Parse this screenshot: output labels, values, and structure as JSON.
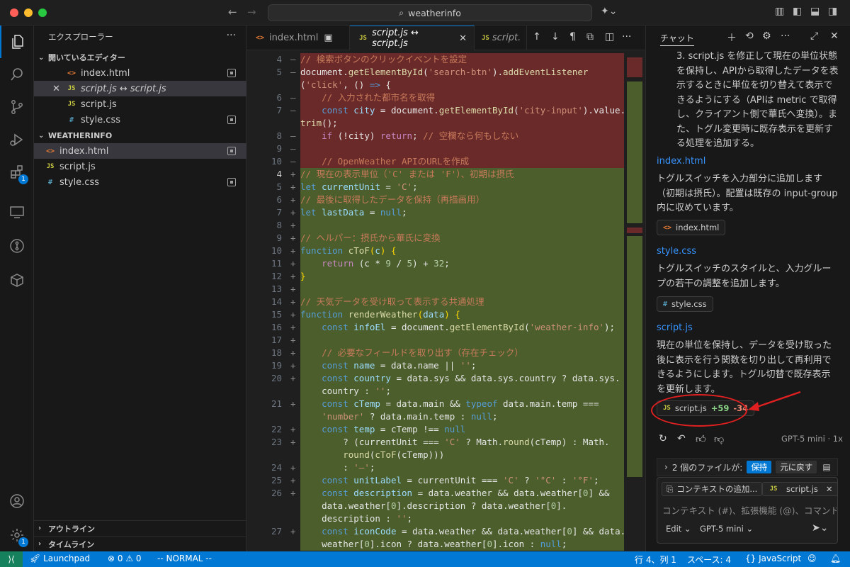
{
  "window": {
    "search_text": "weatherinfo"
  },
  "activity_bar": {
    "extensions_badge": "1",
    "settings_badge": "1"
  },
  "explorer": {
    "title": "エクスプローラー",
    "open_editors_header": "開いているエディター",
    "open_editors": [
      {
        "name": "index.html",
        "type": "html"
      },
      {
        "name": "script.js ↔ script.js",
        "type": "js"
      },
      {
        "name": "script.js",
        "type": "js"
      },
      {
        "name": "style.css",
        "type": "css"
      }
    ],
    "folder_header": "WEATHERINFO",
    "files": [
      {
        "name": "index.html",
        "type": "html"
      },
      {
        "name": "script.js",
        "type": "js"
      },
      {
        "name": "style.css",
        "type": "css"
      }
    ],
    "outline_header": "アウトライン",
    "timeline_header": "タイムライン"
  },
  "tabs": [
    {
      "label": "index.html"
    },
    {
      "label": "script.js ↔ script.js"
    },
    {
      "label": "script."
    }
  ],
  "editor": {
    "lines": [
      {
        "ln": "4",
        "kind": "del",
        "gm": "—",
        "html": "<span class=\"c-com\">// 検索ボタンのクリックイベントを設定</span>"
      },
      {
        "ln": "5",
        "kind": "del",
        "gm": "—",
        "html": "<span class=\"c-txt\">document.</span><span class=\"c-fn\">getElementById</span><span class=\"c-txt\">(</span><span class=\"c-str\">'search-btn'</span><span class=\"c-txt\">).</span><span class=\"c-fn\">addEventListener</span>"
      },
      {
        "ln": "",
        "kind": "del",
        "gm": "",
        "html": "<span class=\"c-txt\">(</span><span class=\"c-str\">'click'</span><span class=\"c-txt\">, () </span><span class=\"c-kw\">=&gt;</span><span class=\"c-txt\"> {</span>"
      },
      {
        "ln": "6",
        "kind": "del",
        "gm": "—",
        "html": "    <span class=\"c-com\">// 入力された都市名を取得</span>"
      },
      {
        "ln": "7",
        "kind": "del",
        "gm": "—",
        "html": "    <span class=\"c-kw\">const</span> <span class=\"c-var\">city</span><span class=\"c-txt\"> = document.</span><span class=\"c-fn\">getElementById</span><span class=\"c-txt\">(</span><span class=\"c-str\">'city-input'</span><span class=\"c-txt\">).value.</span>"
      },
      {
        "ln": "",
        "kind": "del",
        "gm": "",
        "html": "<span class=\"c-fn\">trim</span><span class=\"c-txt\">();</span>"
      },
      {
        "ln": "8",
        "kind": "del",
        "gm": "—",
        "html": "    <span class=\"c-ctl\">if</span><span class=\"c-txt\"> (!city) </span><span class=\"c-ctl\">return</span><span class=\"c-txt\">; </span><span class=\"c-com\">// 空欄なら何もしない</span>"
      },
      {
        "ln": "9",
        "kind": "del",
        "gm": "—",
        "html": ""
      },
      {
        "ln": "10",
        "kind": "del",
        "gm": "—",
        "html": "    <span class=\"c-com\">// OpenWeather APIのURLを作成</span>"
      },
      {
        "ln": "4",
        "kind": "add",
        "gm": "+",
        "cur": true,
        "html": "<span class=\"c-com\">// 現在の表示単位（'C' または 'F'）、初期は摂氏</span>"
      },
      {
        "ln": "5",
        "kind": "add",
        "gm": "+",
        "html": "<span class=\"c-kw\">let</span> <span class=\"c-var\">currentUnit</span><span class=\"c-txt\"> = </span><span class=\"c-str\">'C'</span><span class=\"c-txt\">;</span>"
      },
      {
        "ln": "6",
        "kind": "add",
        "gm": "+",
        "html": "<span class=\"c-com\">// 最後に取得したデータを保持（再描画用）</span>"
      },
      {
        "ln": "7",
        "kind": "add",
        "gm": "+",
        "html": "<span class=\"c-kw\">let</span> <span class=\"c-var\">lastData</span><span class=\"c-txt\"> = </span><span class=\"c-kw\">null</span><span class=\"c-txt\">;</span>"
      },
      {
        "ln": "8",
        "kind": "add",
        "gm": "+",
        "html": ""
      },
      {
        "ln": "9",
        "kind": "add",
        "gm": "+",
        "html": "<span class=\"c-com\">// ヘルパー：摂氏から華氏に変換</span>"
      },
      {
        "ln": "10",
        "kind": "add",
        "gm": "+",
        "html": "<span class=\"c-kw\">function</span> <span class=\"c-fn\">cToF</span><span class=\"c-br\">(</span><span class=\"c-var\">c</span><span class=\"c-br\">)</span><span class=\"c-txt\"> </span><span class=\"c-br\">{</span>"
      },
      {
        "ln": "11",
        "kind": "add",
        "gm": "+",
        "html": "    <span class=\"c-ctl\">return</span><span class=\"c-txt\"> (c * </span><span class=\"c-num\">9</span><span class=\"c-txt\"> / </span><span class=\"c-num\">5</span><span class=\"c-txt\">) + </span><span class=\"c-num\">32</span><span class=\"c-txt\">;</span>"
      },
      {
        "ln": "12",
        "kind": "add",
        "gm": "+",
        "html": "<span class=\"c-br\">}</span>"
      },
      {
        "ln": "13",
        "kind": "add",
        "gm": "+",
        "html": ""
      },
      {
        "ln": "14",
        "kind": "add",
        "gm": "+",
        "html": "<span class=\"c-com\">// 天気データを受け取って表示する共通処理</span>"
      },
      {
        "ln": "15",
        "kind": "add",
        "gm": "+",
        "html": "<span class=\"c-kw\">function</span> <span class=\"c-fn\">renderWeather</span><span class=\"c-br\">(</span><span class=\"c-var\">data</span><span class=\"c-br\">)</span><span class=\"c-txt\"> </span><span class=\"c-br\">{</span>"
      },
      {
        "ln": "16",
        "kind": "add",
        "gm": "+",
        "html": "    <span class=\"c-kw\">const</span> <span class=\"c-var\">infoEl</span><span class=\"c-txt\"> = document.</span><span class=\"c-fn\">getElementById</span><span class=\"c-txt\">(</span><span class=\"c-str\">'weather-info'</span><span class=\"c-txt\">);</span>"
      },
      {
        "ln": "17",
        "kind": "add",
        "gm": "+",
        "html": ""
      },
      {
        "ln": "18",
        "kind": "add",
        "gm": "+",
        "html": "    <span class=\"c-com\">// 必要なフィールドを取り出す（存在チェック）</span>"
      },
      {
        "ln": "19",
        "kind": "add",
        "gm": "+",
        "html": "    <span class=\"c-kw\">const</span> <span class=\"c-var\">name</span><span class=\"c-txt\"> = data.name || </span><span class=\"c-str\">''</span><span class=\"c-txt\">;</span>"
      },
      {
        "ln": "20",
        "kind": "add",
        "gm": "+",
        "html": "    <span class=\"c-kw\">const</span> <span class=\"c-var\">country</span><span class=\"c-txt\"> = data.sys &amp;&amp; data.sys.country ? data.sys.</span>"
      },
      {
        "ln": "",
        "kind": "add",
        "gm": "",
        "html": "    <span class=\"c-txt\">country : </span><span class=\"c-str\">''</span><span class=\"c-txt\">;</span>"
      },
      {
        "ln": "21",
        "kind": "add",
        "gm": "+",
        "html": "    <span class=\"c-kw\">const</span> <span class=\"c-var\">cTemp</span><span class=\"c-txt\"> = data.main &amp;&amp; </span><span class=\"c-kw\">typeof</span><span class=\"c-txt\"> data.main.temp ===</span>"
      },
      {
        "ln": "",
        "kind": "add",
        "gm": "",
        "html": "    <span class=\"c-str\">'number'</span><span class=\"c-txt\"> ? data.main.temp : </span><span class=\"c-kw\">null</span><span class=\"c-txt\">;</span>"
      },
      {
        "ln": "22",
        "kind": "add",
        "gm": "+",
        "html": "    <span class=\"c-kw\">const</span> <span class=\"c-var\">temp</span><span class=\"c-txt\"> = cTemp !== </span><span class=\"c-kw\">null</span>"
      },
      {
        "ln": "23",
        "kind": "add",
        "gm": "+",
        "html": "        <span class=\"c-txt\">? (currentUnit === </span><span class=\"c-str\">'C'</span><span class=\"c-txt\"> ? Math.</span><span class=\"c-fn\">round</span><span class=\"c-txt\">(cTemp) : Math.</span>"
      },
      {
        "ln": "",
        "kind": "add",
        "gm": "",
        "html": "        <span class=\"c-fn\">round</span><span class=\"c-txt\">(</span><span class=\"c-fn\">cToF</span><span class=\"c-txt\">(cTemp)))</span>"
      },
      {
        "ln": "24",
        "kind": "add",
        "gm": "+",
        "html": "        <span class=\"c-txt\">: </span><span class=\"c-str\">'—'</span><span class=\"c-txt\">;</span>"
      },
      {
        "ln": "25",
        "kind": "add",
        "gm": "+",
        "html": "    <span class=\"c-kw\">const</span> <span class=\"c-var\">unitLabel</span><span class=\"c-txt\"> = currentUnit === </span><span class=\"c-str\">'C'</span><span class=\"c-txt\"> ? </span><span class=\"c-str\">'°C'</span><span class=\"c-txt\"> : </span><span class=\"c-str\">'°F'</span><span class=\"c-txt\">;</span>"
      },
      {
        "ln": "26",
        "kind": "add",
        "gm": "+",
        "html": "    <span class=\"c-kw\">const</span> <span class=\"c-var\">description</span><span class=\"c-txt\"> = data.weather &amp;&amp; data.weather[</span><span class=\"c-num\">0</span><span class=\"c-txt\">] &amp;&amp;</span>"
      },
      {
        "ln": "",
        "kind": "add",
        "gm": "",
        "html": "    <span class=\"c-txt\">data.weather[</span><span class=\"c-num\">0</span><span class=\"c-txt\">].description ? data.weather[</span><span class=\"c-num\">0</span><span class=\"c-txt\">].</span>"
      },
      {
        "ln": "",
        "kind": "add",
        "gm": "",
        "html": "    <span class=\"c-txt\">description : </span><span class=\"c-str\">''</span><span class=\"c-txt\">;</span>"
      },
      {
        "ln": "27",
        "kind": "add",
        "gm": "+",
        "html": "    <span class=\"c-kw\">const</span> <span class=\"c-var\">iconCode</span><span class=\"c-txt\"> = data.weather &amp;&amp; data.weather[</span><span class=\"c-num\">0</span><span class=\"c-txt\">] &amp;&amp; data.</span>"
      },
      {
        "ln": "",
        "kind": "add",
        "gm": "",
        "html": "    <span class=\"c-txt\">weather[</span><span class=\"c-num\">0</span><span class=\"c-txt\">].icon ? data.weather[</span><span class=\"c-num\">0</span><span class=\"c-txt\">].icon : </span><span class=\"c-kw\">null</span><span class=\"c-txt\">;</span>"
      }
    ]
  },
  "chat": {
    "title": "チャット",
    "intro_item": "3. script.js を修正して現在の単位状態を保持し、APIから取得したデータを表示するときに単位を切り替えて表示できるようにする（APIは metric で取得し、クライアント側で華氏へ変換）。また、トグル変更時に既存表示を更新する処理を追加する。",
    "sections": [
      {
        "link": "index.html",
        "text": "トグルスイッチを入力部分に追加します（初期は摂氏）。配置は既存の input-group 内に収めています。",
        "chip": "index.html"
      },
      {
        "link": "style.css",
        "text": "トグルスイッチのスタイルと、入力グループの若干の調整を追加します。",
        "chip": "style.css"
      },
      {
        "link": "script.js",
        "text": "現在の単位を保持し、データを受け取った後に表示を行う関数を切り出して再利用できるようにします。トグル切替で既存表示を更新します。"
      }
    ],
    "edit_chip": {
      "file": "script.js",
      "added": "+59",
      "removed": "-34"
    },
    "model_tag": "GPT-5 mini · 1x",
    "files_changed": "2 個のファイルが:",
    "keep_label": "保持",
    "undo_label": "元に戻す",
    "context_button": "コンテキストの追加...",
    "context_file": "script.js",
    "input_placeholder": "コンテキスト (#)、拡張機能 (@)、コマンド",
    "mode_label": "Edit",
    "model_label": "GPT-5 mini"
  },
  "status": {
    "launchpad": "Launchpad",
    "errors": "0",
    "warnings": "0",
    "mode": "-- NORMAL --",
    "position": "行 4、列 1",
    "spaces": "スペース: 4",
    "language": "JavaScript"
  },
  "colors": {
    "accent": "#0078d4",
    "deleted_bg": "#6b2a2a",
    "added_bg": "#4b5e2c",
    "annotation": "#e02020"
  }
}
